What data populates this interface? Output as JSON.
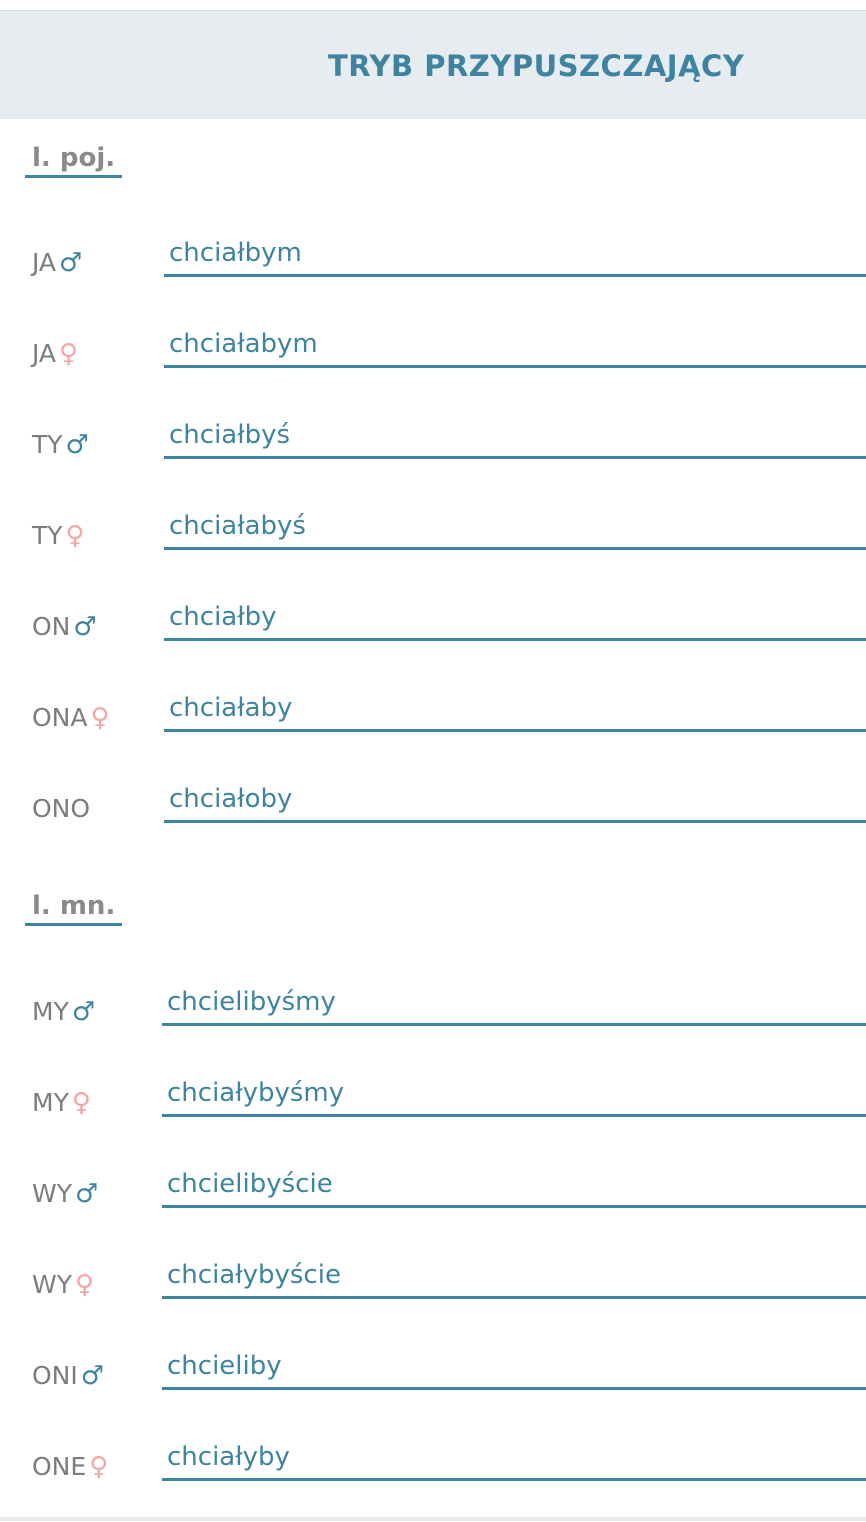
{
  "header": {
    "title": "TRYB PRZYPUSZCZAJĄCY"
  },
  "sections": [
    {
      "label": "l. poj.",
      "rows": [
        {
          "pronoun": "JA",
          "gender_icon": "male-icon",
          "gender_glyph": "♂",
          "value": "chciałbym"
        },
        {
          "pronoun": "JA",
          "gender_icon": "female-icon",
          "gender_glyph": "♀",
          "value": "chciałabym"
        },
        {
          "pronoun": "TY",
          "gender_icon": "male-icon",
          "gender_glyph": "♂",
          "value": "chciałbyś"
        },
        {
          "pronoun": "TY",
          "gender_icon": "female-icon",
          "gender_glyph": "♀",
          "value": "chciałabyś"
        },
        {
          "pronoun": "ON",
          "gender_icon": "male-icon",
          "gender_glyph": "♂",
          "value": "chciałby"
        },
        {
          "pronoun": "ONA",
          "gender_icon": "female-icon",
          "gender_glyph": "♀",
          "value": "chciałaby"
        },
        {
          "pronoun": "ONO",
          "gender_icon": "",
          "gender_glyph": "",
          "value": "chciałoby"
        }
      ]
    },
    {
      "label": "l. mn.",
      "rows": [
        {
          "pronoun": "MY",
          "gender_icon": "male-icon",
          "gender_glyph": "♂",
          "value": "chcielibyśmy"
        },
        {
          "pronoun": "MY",
          "gender_icon": "female-icon",
          "gender_glyph": "♀",
          "value": "chciałybyśmy"
        },
        {
          "pronoun": "WY",
          "gender_icon": "male-icon",
          "gender_glyph": "♂",
          "value": "chcielibyście"
        },
        {
          "pronoun": "WY",
          "gender_icon": "female-icon",
          "gender_glyph": "♀",
          "value": "chciałybyście"
        },
        {
          "pronoun": "ONI",
          "gender_icon": "male-icon",
          "gender_glyph": "♂",
          "value": "chcieliby"
        },
        {
          "pronoun": "ONE",
          "gender_icon": "female-icon",
          "gender_glyph": "♀",
          "value": "chciałyby"
        }
      ]
    }
  ],
  "colors": {
    "accent": "#3e84a0",
    "female": "#f2a7a7",
    "pronoun_text": "#7c7c7c",
    "header_bg": "#e7ecf0"
  }
}
